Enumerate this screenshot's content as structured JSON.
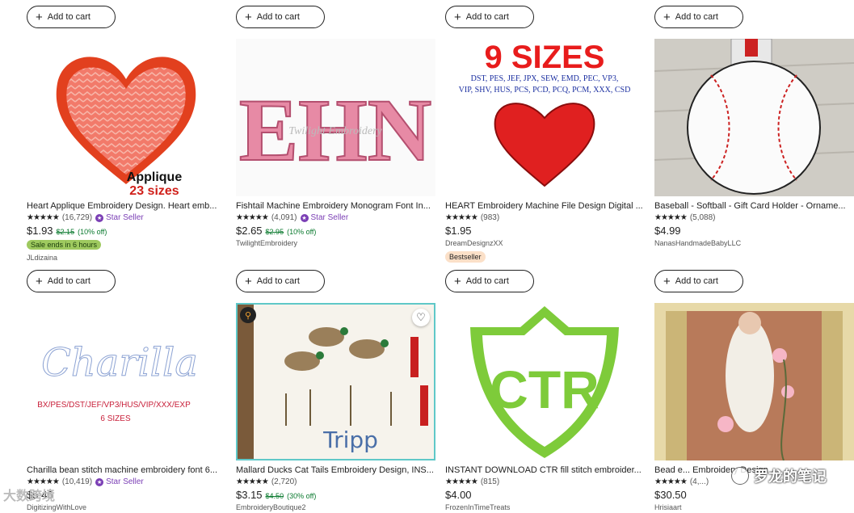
{
  "add_to_cart_label": "Add to cart",
  "row1": [
    {
      "title": "Heart Applique Embroidery Design. Heart emb...",
      "stars": "★★★★★",
      "reviews": "(16,729)",
      "star_seller": "Star Seller",
      "price": "$1.93",
      "orig_price": "$2.15",
      "discount": "(10% off)",
      "sale": "Sale ends in 6 hours",
      "shop": "JLdizaina",
      "img_text_1": "Applique",
      "img_text_2": "23 sizes"
    },
    {
      "title": "Fishtail Machine Embroidery Monogram Font In...",
      "stars": "★★★★★",
      "reviews": "(4,091)",
      "star_seller": "Star Seller",
      "price": "$2.65",
      "orig_price": "$2.95",
      "discount": "(10% off)",
      "shop": "TwilightEmbroidery",
      "img_text_1": "EHN",
      "img_text_2": "Twilight Embroidery"
    },
    {
      "title": "HEART Embroidery Machine File Design Digital ...",
      "stars": "★★★★★",
      "reviews": "(983)",
      "price": "$1.95",
      "shop": "DreamDesignzXX",
      "bestseller": "Bestseller",
      "img_text_1": "9 SIZES",
      "img_text_2": "DST, PES, JEF, JPX, SEW, EMD, PEC, VP3,",
      "img_text_3": "VIP, SHV, HUS, PCS, PCD, PCQ, PCM, XXX, CSD"
    },
    {
      "title": "Baseball - Softball - Gift Card Holder - Orname...",
      "stars": "★★★★★",
      "reviews": "(5,088)",
      "price": "$4.99",
      "shop": "NanasHandmadeBabyLLC"
    }
  ],
  "row2": [
    {
      "title": "Charilla bean stitch machine embroidery font 6...",
      "stars": "★★★★★",
      "reviews": "(10,419)",
      "star_seller": "Star Seller",
      "price": "$5.46",
      "shop": "DigitizingWithLove",
      "img_text_1": "Charilla",
      "img_text_2": "BX/PES/DST/JEF/VP3/HUS/VIP/XXX/EXP",
      "img_text_3": "6 SIZES"
    },
    {
      "title": "Mallard Ducks Cat Tails Embroidery Design, INS...",
      "stars": "★★★★★",
      "reviews": "(2,720)",
      "price": "$3.15",
      "orig_price": "$4.50",
      "discount": "(30% off)",
      "shop": "EmbroideryBoutique2",
      "img_text_1": "Tripp"
    },
    {
      "title": "INSTANT DOWNLOAD CTR fill stitch embroider...",
      "stars": "★★★★★",
      "reviews": "(815)",
      "price": "$4.00",
      "shop": "FrozenInTimeTreats",
      "img_text_1": "CTR"
    },
    {
      "title": "Bead e...  Embroidery Design ...",
      "stars": "★★★★★",
      "reviews": "(4,...)",
      "price": "$30.50",
      "shop": "Hrisiaart"
    }
  ],
  "watermark_left": "大数跨境",
  "watermark_right": "罗龙的笔记",
  "colors": {
    "star_seller": "#7b3fb5",
    "sale_green": "#9ec95f",
    "discount_green": "#0b7a2f",
    "bestseller_bg": "#fbe0c8"
  }
}
